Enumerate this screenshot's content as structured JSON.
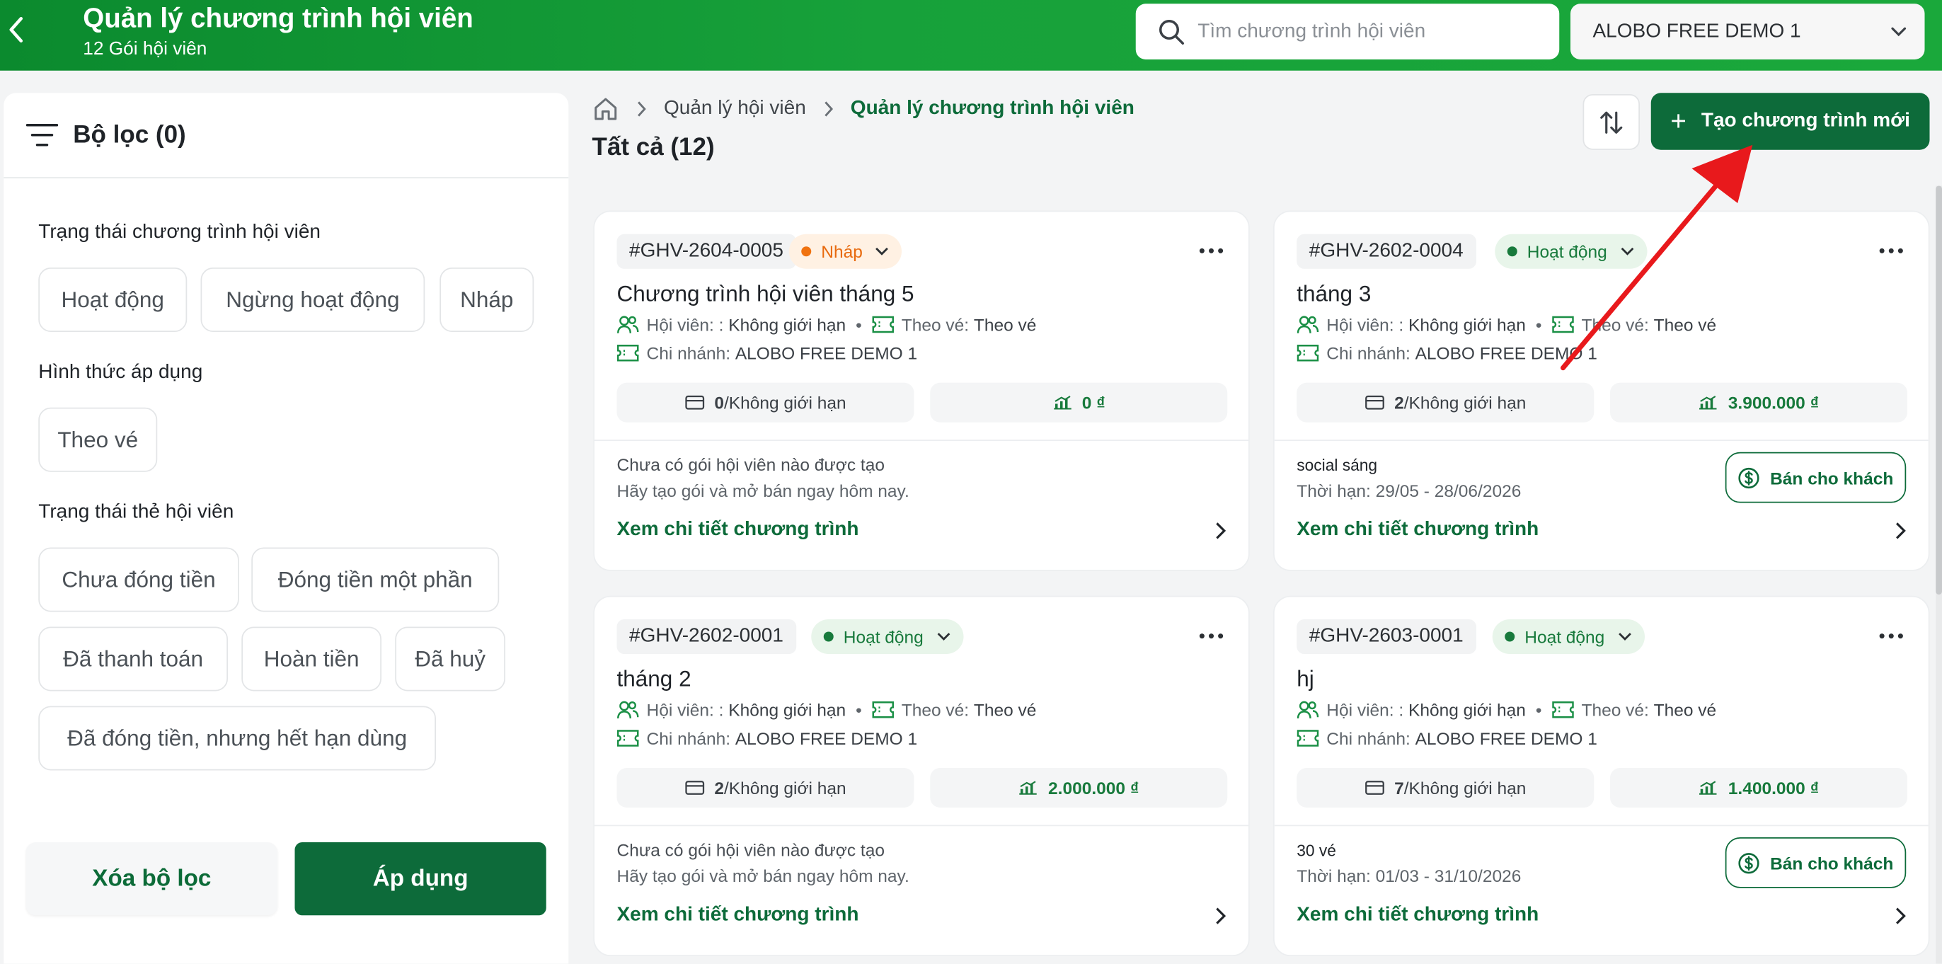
{
  "header": {
    "title": "Quản lý chương trình hội viên",
    "subtitle": "12 Gói hội viên",
    "search_placeholder": "Tìm chương trình hội viên",
    "branch": "ALOBO FREE DEMO 1",
    "bg_color": "#16a03a"
  },
  "filter": {
    "title": "Bộ lọc (0)",
    "program_status_label": "Trạng thái chương trình hội viên",
    "program_status_options": [
      "Hoạt động",
      "Ngừng hoạt động",
      "Nháp"
    ],
    "apply_type_label": "Hình thức áp dụng",
    "apply_type_options": [
      "Theo vé"
    ],
    "card_status_label": "Trạng thái thẻ hội viên",
    "card_status_options": [
      "Chưa đóng tiền",
      "Đóng tiền một phần",
      "Đã thanh toán",
      "Hoàn tiền",
      "Đã huỷ",
      "Đã đóng tiền, nhưng hết hạn dùng"
    ],
    "clear_label": "Xóa bộ lọc",
    "apply_label": "Áp dụng"
  },
  "breadcrumb": [
    "Quản lý hội viên",
    "Quản lý chương trình hội viên"
  ],
  "main": {
    "all_count": "Tất cả (12)",
    "create_label": "Tạo chương trình mới",
    "accent_color": "#0d6b3a"
  },
  "cards": [
    {
      "code": "#GHV-2604-0005",
      "status": "Nháp",
      "name": "Chương trình hội viên tháng 5",
      "members_label": "Hội viên: :",
      "members_value": "Không giới hạn",
      "ticket_label": "Theo vé:",
      "ticket_value": "Theo vé",
      "branch_label": "Chi nhánh:",
      "branch_value": "ALOBO FREE DEMO 1",
      "count": "0",
      "count_suffix": "/Không giới hạn",
      "revenue": "0 ₫",
      "empty_title": "Chưa có gói hội viên nào được tạo",
      "empty_sub": "Hãy tạo gói và mở bán ngay hôm nay.",
      "detail_label": "Xem chi tiết chương trình"
    },
    {
      "code": "#GHV-2602-0004",
      "status": "Hoạt động",
      "name": "tháng 3",
      "members_label": "Hội viên: :",
      "members_value": "Không giới hạn",
      "ticket_label": "Theo vé:",
      "ticket_value": "Theo vé",
      "branch_label": "Chi nhánh:",
      "branch_value": "ALOBO FREE DEMO 1",
      "count": "2",
      "count_suffix": "/Không giới hạn",
      "revenue": "3.900.000 ₫",
      "package_name": "social sáng",
      "period": "Thời hạn: 29/05 - 28/06/2026",
      "sell_label": "Bán cho khách",
      "detail_label": "Xem chi tiết chương trình"
    },
    {
      "code": "#GHV-2602-0001",
      "status": "Hoạt động",
      "name": "tháng 2",
      "members_label": "Hội viên: :",
      "members_value": "Không giới hạn",
      "ticket_label": "Theo vé:",
      "ticket_value": "Theo vé",
      "branch_label": "Chi nhánh:",
      "branch_value": "ALOBO FREE DEMO 1",
      "count": "2",
      "count_suffix": "/Không giới hạn",
      "revenue": "2.000.000 ₫",
      "empty_title": "Chưa có gói hội viên nào được tạo",
      "empty_sub": "Hãy tạo gói và mở bán ngay hôm nay.",
      "detail_label": "Xem chi tiết chương trình"
    },
    {
      "code": "#GHV-2603-0001",
      "status": "Hoạt động",
      "name": "hj",
      "members_label": "Hội viên: :",
      "members_value": "Không giới hạn",
      "ticket_label": "Theo vé:",
      "ticket_value": "Theo vé",
      "branch_label": "Chi nhánh:",
      "branch_value": "ALOBO FREE DEMO 1",
      "count": "7",
      "count_suffix": "/Không giới hạn",
      "revenue": "1.400.000 ₫",
      "package_name": "30 vé",
      "period": "Thời hạn: 01/03 - 31/10/2026",
      "sell_label": "Bán cho khách",
      "detail_label": "Xem chi tiết chương trình"
    }
  ],
  "annotation": {
    "arrow_color": "#e8191c"
  }
}
